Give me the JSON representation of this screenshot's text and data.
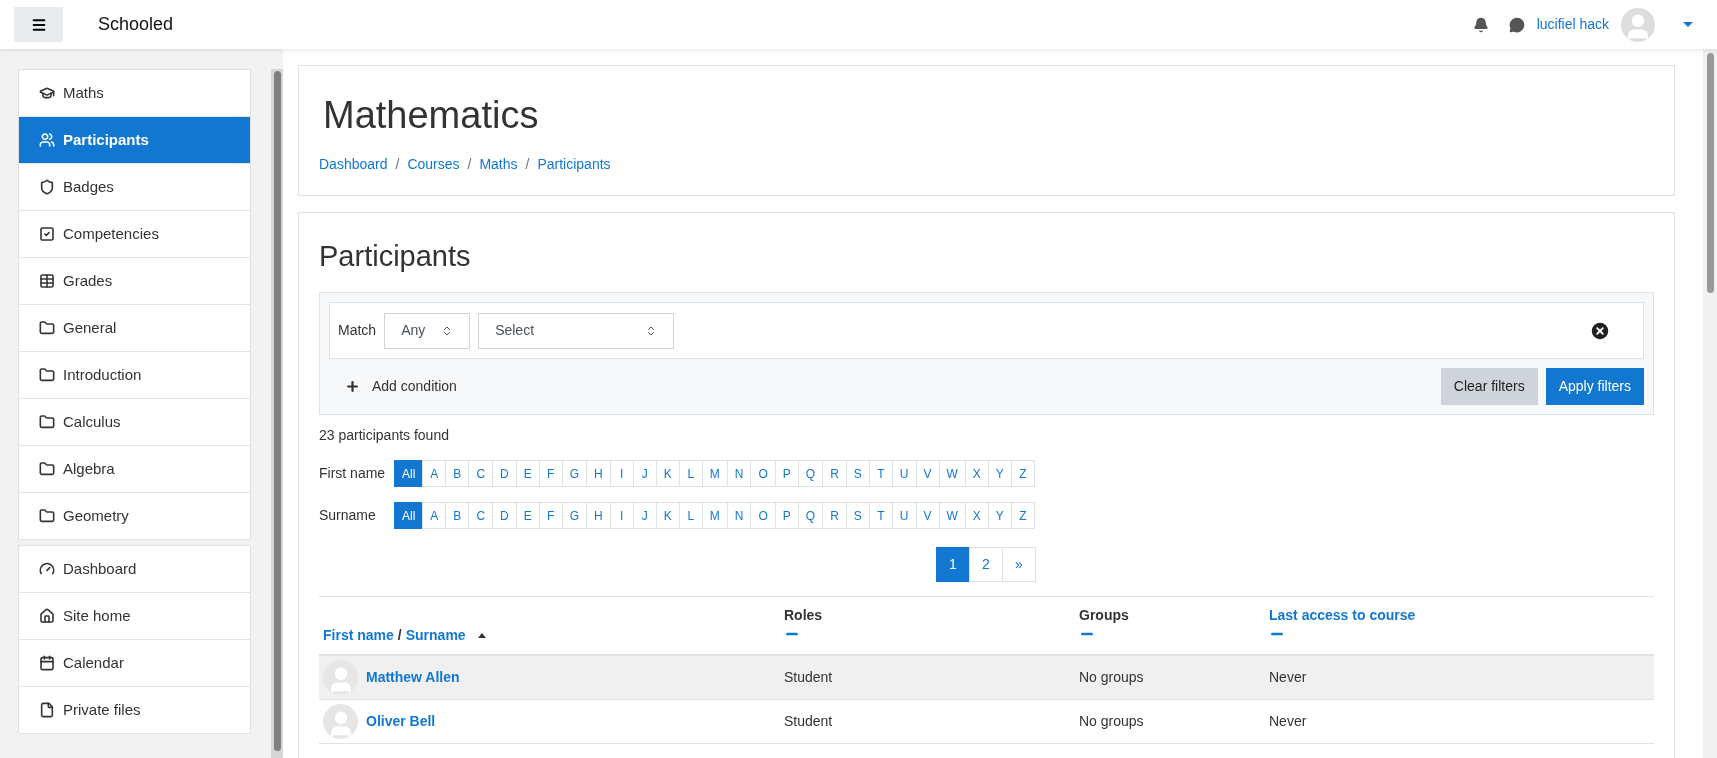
{
  "navbar": {
    "site_name": "Schooled",
    "user_name": "lucifiel hack"
  },
  "sidebar": {
    "groups": [
      [
        {
          "label": "Maths",
          "selected": false
        },
        {
          "label": "Participants",
          "selected": true
        },
        {
          "label": "Badges",
          "selected": false
        },
        {
          "label": "Competencies",
          "selected": false
        },
        {
          "label": "Grades",
          "selected": false
        },
        {
          "label": "General",
          "selected": false
        },
        {
          "label": "Introduction",
          "selected": false
        },
        {
          "label": "Calculus",
          "selected": false
        },
        {
          "label": "Algebra",
          "selected": false
        },
        {
          "label": "Geometry",
          "selected": false
        }
      ],
      [
        {
          "label": "Dashboard",
          "selected": false
        },
        {
          "label": "Site home",
          "selected": false
        },
        {
          "label": "Calendar",
          "selected": false
        },
        {
          "label": "Private files",
          "selected": false
        }
      ]
    ]
  },
  "header": {
    "title": "Mathematics",
    "breadcrumb": [
      "Dashboard",
      "Courses",
      "Maths",
      "Participants"
    ],
    "breadcrumb_separator": "/"
  },
  "participants": {
    "title": "Participants",
    "filter": {
      "match_label": "Match",
      "match_value": "Any",
      "condition_value": "Select",
      "add_condition": "Add condition",
      "clear": "Clear filters",
      "apply": "Apply filters"
    },
    "count": "23 participants found",
    "initials_bars": [
      {
        "label": "First name",
        "letters": [
          {
            "text": "All",
            "selected": true
          },
          {
            "text": "A",
            "selected": false
          },
          {
            "text": "B",
            "selected": false
          },
          {
            "text": "C",
            "selected": false
          },
          {
            "text": "D",
            "selected": false
          },
          {
            "text": "E",
            "selected": false
          },
          {
            "text": "F",
            "selected": false
          },
          {
            "text": "G",
            "selected": false
          },
          {
            "text": "H",
            "selected": false
          },
          {
            "text": "I",
            "selected": false
          },
          {
            "text": "J",
            "selected": false
          },
          {
            "text": "K",
            "selected": false
          },
          {
            "text": "L",
            "selected": false
          },
          {
            "text": "M",
            "selected": false
          },
          {
            "text": "N",
            "selected": false
          },
          {
            "text": "O",
            "selected": false
          },
          {
            "text": "P",
            "selected": false
          },
          {
            "text": "Q",
            "selected": false
          },
          {
            "text": "R",
            "selected": false
          },
          {
            "text": "S",
            "selected": false
          },
          {
            "text": "T",
            "selected": false
          },
          {
            "text": "U",
            "selected": false
          },
          {
            "text": "V",
            "selected": false
          },
          {
            "text": "W",
            "selected": false
          },
          {
            "text": "X",
            "selected": false
          },
          {
            "text": "Y",
            "selected": false
          },
          {
            "text": "Z",
            "selected": false
          }
        ]
      },
      {
        "label": "Surname",
        "letters": [
          {
            "text": "All",
            "selected": true
          },
          {
            "text": "A",
            "selected": false
          },
          {
            "text": "B",
            "selected": false
          },
          {
            "text": "C",
            "selected": false
          },
          {
            "text": "D",
            "selected": false
          },
          {
            "text": "E",
            "selected": false
          },
          {
            "text": "F",
            "selected": false
          },
          {
            "text": "G",
            "selected": false
          },
          {
            "text": "H",
            "selected": false
          },
          {
            "text": "I",
            "selected": false
          },
          {
            "text": "J",
            "selected": false
          },
          {
            "text": "K",
            "selected": false
          },
          {
            "text": "L",
            "selected": false
          },
          {
            "text": "M",
            "selected": false
          },
          {
            "text": "N",
            "selected": false
          },
          {
            "text": "O",
            "selected": false
          },
          {
            "text": "P",
            "selected": false
          },
          {
            "text": "Q",
            "selected": false
          },
          {
            "text": "R",
            "selected": false
          },
          {
            "text": "S",
            "selected": false
          },
          {
            "text": "T",
            "selected": false
          },
          {
            "text": "U",
            "selected": false
          },
          {
            "text": "V",
            "selected": false
          },
          {
            "text": "W",
            "selected": false
          },
          {
            "text": "X",
            "selected": false
          },
          {
            "text": "Y",
            "selected": false
          },
          {
            "text": "Z",
            "selected": false
          }
        ]
      }
    ],
    "pagination": [
      {
        "text": "1",
        "selected": true
      },
      {
        "text": "2",
        "selected": false
      },
      {
        "text": "»",
        "selected": false
      }
    ],
    "table": {
      "name_separator": "/",
      "columns": [
        {
          "parts": [
            "First name",
            "Surname"
          ],
          "link": true
        },
        {
          "parts": [
            "Roles"
          ],
          "link": false
        },
        {
          "parts": [
            "Groups"
          ],
          "link": false
        },
        {
          "parts": [
            "Last access to course"
          ],
          "link": true
        }
      ],
      "rows": [
        {
          "name": "Matthew Allen",
          "role": "Student",
          "groups": "No groups",
          "last_access": "Never",
          "highlighted": true
        },
        {
          "name": "Oliver Bell",
          "role": "Student",
          "groups": "No groups",
          "last_access": "Never",
          "highlighted": false
        }
      ]
    }
  }
}
